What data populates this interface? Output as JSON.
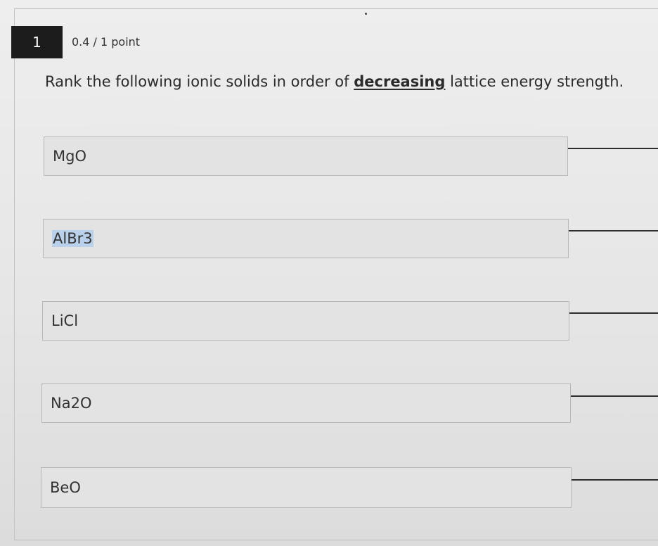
{
  "question": {
    "number": "1",
    "points": "0.4 / 1 point",
    "prompt_before": "Rank the following ionic solids in order of ",
    "prompt_emphasis": "decreasing",
    "prompt_after": " lattice energy strength."
  },
  "items": [
    {
      "label": "MgO"
    },
    {
      "label": "AlBr3",
      "highlighted": true
    },
    {
      "label": "LiCl"
    },
    {
      "label": "Na2O"
    },
    {
      "label": "BeO"
    }
  ]
}
